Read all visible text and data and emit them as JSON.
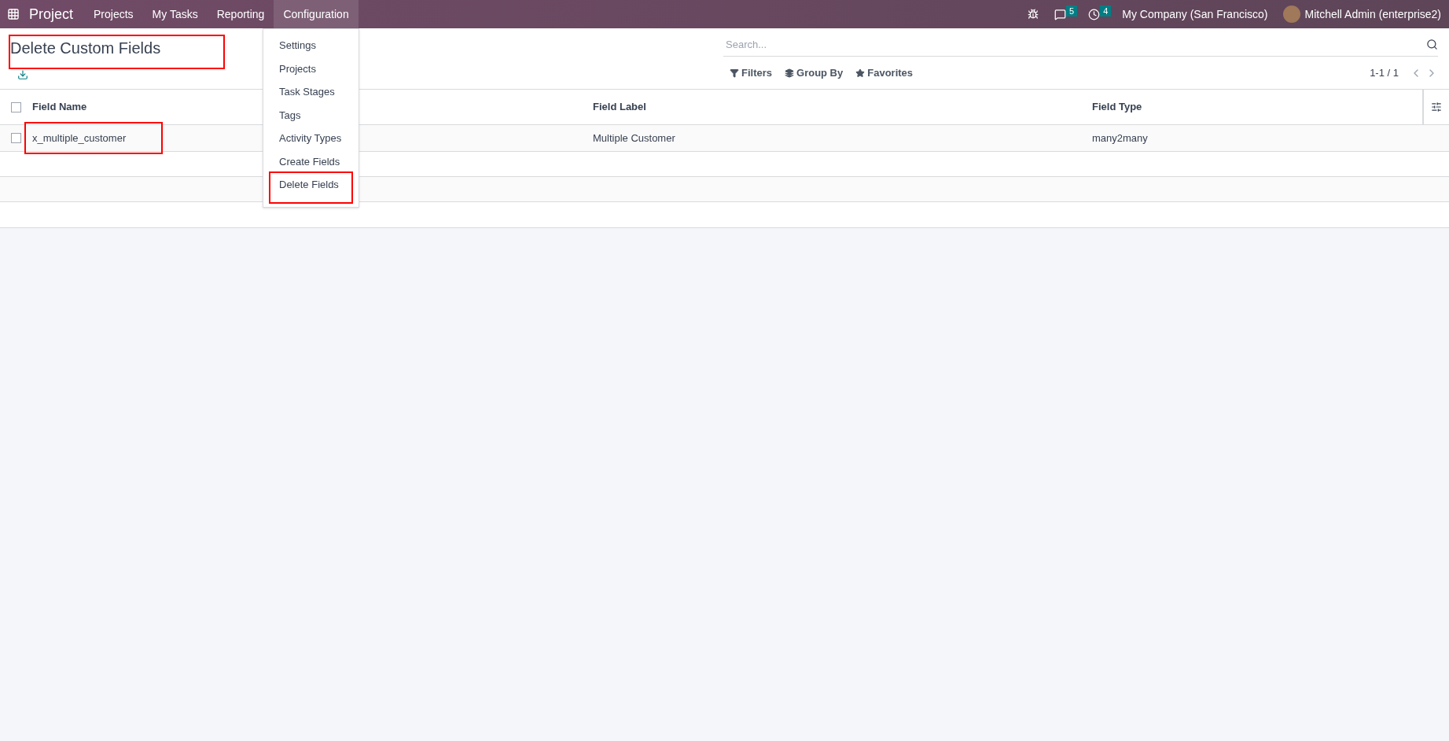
{
  "navbar": {
    "app_name": "Project",
    "menus": [
      {
        "label": "Projects",
        "selected": false
      },
      {
        "label": "My Tasks",
        "selected": false
      },
      {
        "label": "Reporting",
        "selected": false
      },
      {
        "label": "Configuration",
        "selected": true
      }
    ],
    "messages_count": "5",
    "activities_count": "4",
    "company": "My Company (San Francisco)",
    "user": "Mitchell Admin (enterprise2)"
  },
  "dropdown": {
    "items": [
      {
        "label": "Settings",
        "highlighted": false
      },
      {
        "label": "Projects",
        "highlighted": false
      },
      {
        "label": "Task Stages",
        "highlighted": false
      },
      {
        "label": "Tags",
        "highlighted": false
      },
      {
        "label": "Activity Types",
        "highlighted": false
      },
      {
        "label": "Create Fields",
        "highlighted": false
      },
      {
        "label": "Delete Fields",
        "highlighted": true
      }
    ]
  },
  "page": {
    "title": "Delete Custom Fields",
    "title_highlighted": true
  },
  "search": {
    "placeholder": "Search..."
  },
  "search_options": [
    "Filters",
    "Group By",
    "Favorites"
  ],
  "pager": "1-1 / 1",
  "table": {
    "select_all_checked": false,
    "columns": [
      "Field Name",
      "Field Label",
      "Field Type"
    ],
    "rows": [
      {
        "checked": false,
        "cells": [
          {
            "text": "x_multiple_customer",
            "highlighted": true
          },
          {
            "text": "Multiple Customer",
            "highlighted": false
          },
          {
            "text": "many2many",
            "highlighted": false
          }
        ]
      }
    ]
  }
}
